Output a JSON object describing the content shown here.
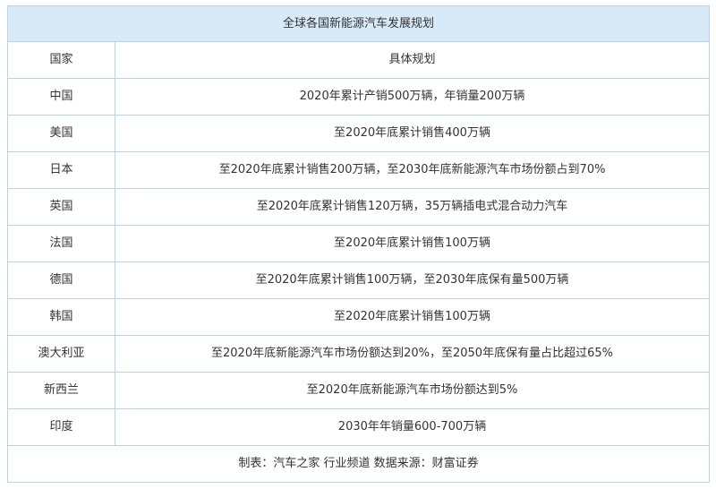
{
  "table": {
    "title": "全球各国新能源汽车发展规划",
    "header": {
      "country": "国家",
      "plan": "具体规划"
    },
    "rows": [
      {
        "country": "中国",
        "plan": "2020年累计产销500万辆，年销量200万辆"
      },
      {
        "country": "美国",
        "plan": "至2020年底累计销售400万辆"
      },
      {
        "country": "日本",
        "plan": "至2020年底累计销售200万辆，至2030年底新能源汽车市场份额占到70%"
      },
      {
        "country": "英国",
        "plan": "至2020年底累计销售120万辆，35万辆插电式混合动力汽车"
      },
      {
        "country": "法国",
        "plan": "至2020年底累计销售100万辆"
      },
      {
        "country": "德国",
        "plan": "至2020年底累计销售100万辆，至2030年底保有量500万辆"
      },
      {
        "country": "韩国",
        "plan": "至2020年底累计销售100万辆"
      },
      {
        "country": "澳大利亚",
        "plan": "至2020年底新能源汽车市场份额达到20%，至2050年底保有量占比超过65%"
      },
      {
        "country": "新西兰",
        "plan": "至2020年底新能源汽车市场份额达到5%"
      },
      {
        "country": "印度",
        "plan": "2030年年销量600-700万辆"
      }
    ],
    "footer": "制表：汽车之家 行业频道 数据来源：财富证券"
  },
  "colors": {
    "title_bg": "#d8e9f8",
    "border": "#b9d3ea",
    "text": "#333333"
  }
}
